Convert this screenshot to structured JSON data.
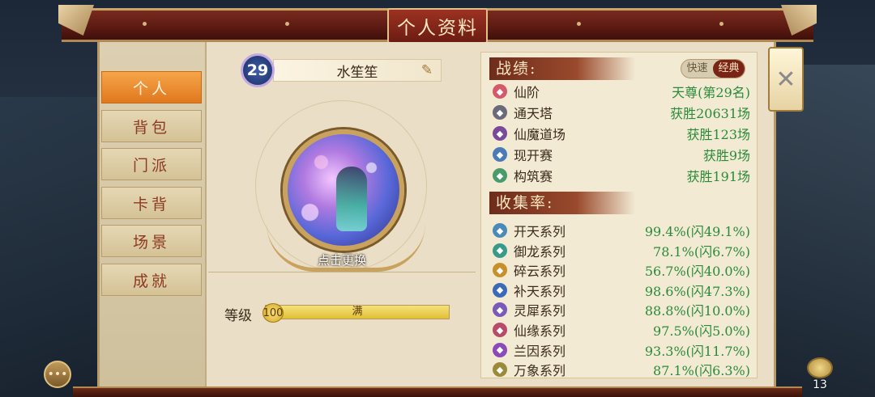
{
  "title": "个人资料",
  "sidebar": {
    "items": [
      {
        "label": "个人",
        "active": true
      },
      {
        "label": "背包",
        "active": false
      },
      {
        "label": "门派",
        "active": false
      },
      {
        "label": "卡背",
        "active": false
      },
      {
        "label": "场景",
        "active": false
      },
      {
        "label": "成就",
        "active": false
      }
    ]
  },
  "profile": {
    "level": "29",
    "name": "水笙笙",
    "change_avatar_label": "点击更换",
    "grade_label": "等级",
    "grade_value": "100",
    "grade_status": "满",
    "grade_progress": 1.0
  },
  "stats": {
    "section_title": "战绩:",
    "toggle": {
      "options": [
        "快速",
        "经典"
      ],
      "selected": "经典"
    },
    "rows": [
      {
        "icon": "star-icon",
        "color": "#d45a6a",
        "label": "仙阶",
        "value": "天尊(第29名)"
      },
      {
        "icon": "tower-icon",
        "color": "#6a6a7a",
        "label": "通天塔",
        "value": "获胜20631场"
      },
      {
        "icon": "demon-icon",
        "color": "#7a4a9a",
        "label": "仙魔道场",
        "value": "获胜123场"
      },
      {
        "icon": "shield-icon",
        "color": "#4a7ab8",
        "label": "现开赛",
        "value": "获胜9场"
      },
      {
        "icon": "leaf-icon",
        "color": "#4a9a6a",
        "label": "构筑赛",
        "value": "获胜191场"
      }
    ]
  },
  "collection": {
    "section_title": "收集率:",
    "rows": [
      {
        "icon": "kaitian-icon",
        "color": "#4a8ab8",
        "label": "开天系列",
        "value": "99.4%(闪49.1%)"
      },
      {
        "icon": "yulong-icon",
        "color": "#3a9a8a",
        "label": "御龙系列",
        "value": "78.1%(闪6.7%)"
      },
      {
        "icon": "cuiyun-icon",
        "color": "#c8902a",
        "label": "碎云系列",
        "value": "56.7%(闪40.0%)"
      },
      {
        "icon": "butian-icon",
        "color": "#3a6ab8",
        "label": "补天系列",
        "value": "98.6%(闪47.3%)"
      },
      {
        "icon": "lingxi-icon",
        "color": "#7a5ab8",
        "label": "灵犀系列",
        "value": "88.8%(闪10.0%)"
      },
      {
        "icon": "xianyuan-icon",
        "color": "#b84a6a",
        "label": "仙缘系列",
        "value": "97.5%(闪5.0%)"
      },
      {
        "icon": "lanyin-icon",
        "color": "#8a4ab8",
        "label": "兰因系列",
        "value": "93.3%(闪11.7%)"
      },
      {
        "icon": "wanxiang-icon",
        "color": "#9a8a3a",
        "label": "万象系列",
        "value": "87.1%(闪6.3%)"
      }
    ]
  },
  "corner_button_count": "13"
}
